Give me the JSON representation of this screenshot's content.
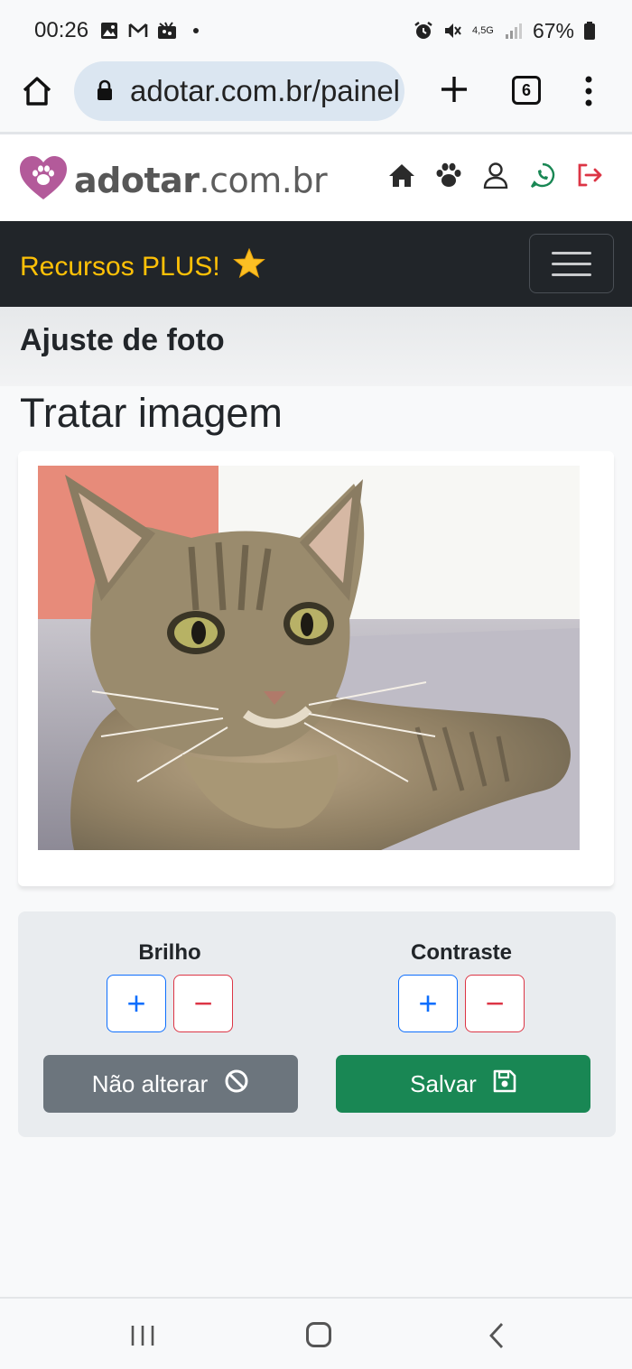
{
  "status_bar": {
    "time": "00:26",
    "network": "4,5G",
    "battery": "67%",
    "icons": [
      "gallery-icon",
      "gmail-icon",
      "app-icon",
      "dot-icon",
      "alarm-icon",
      "mute-icon",
      "signal-icon",
      "battery-icon"
    ]
  },
  "browser": {
    "url": "adotar.com.br/painel",
    "tab_count": "6",
    "icons": [
      "home-icon",
      "lock-icon",
      "new-tab-icon",
      "tabs-icon",
      "more-icon"
    ]
  },
  "site": {
    "logo_bold": "adotar",
    "logo_rest": ".com.br",
    "header_icons": [
      "home-icon",
      "paw-icon",
      "user-icon",
      "whatsapp-icon",
      "logout-icon"
    ],
    "accent_color": "#ffc107",
    "navbar_color": "#212529"
  },
  "navbar": {
    "plus_label": "Recursos PLUS!",
    "star_icon": "star-icon"
  },
  "page": {
    "heading": "Ajuste de foto",
    "section_title": "Tratar imagem"
  },
  "controls": {
    "brightness_label": "Brilho",
    "contrast_label": "Contraste",
    "plus": "+",
    "minus": "−",
    "cancel_label": "Não alterar",
    "save_label": "Salvar",
    "cancel_color": "#6c757d",
    "save_color": "#198754"
  }
}
